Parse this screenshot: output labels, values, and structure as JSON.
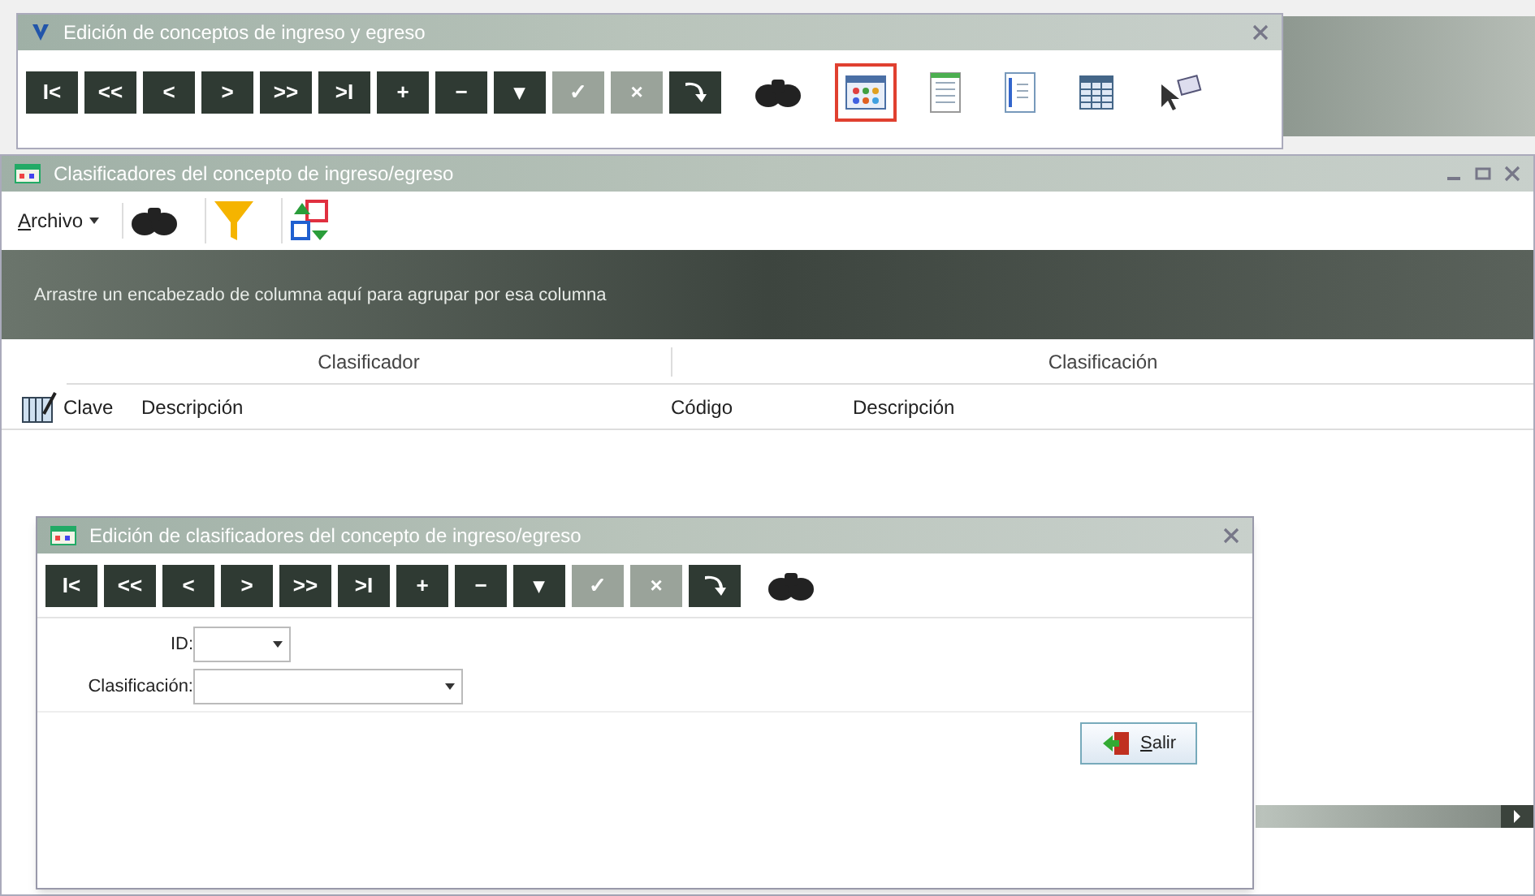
{
  "main_window": {
    "title": "Edición de conceptos de ingreso y egreso",
    "nav_buttons": [
      {
        "label": "I<",
        "disabled": false
      },
      {
        "label": "<<",
        "disabled": false
      },
      {
        "label": "<",
        "disabled": false
      },
      {
        "label": ">",
        "disabled": false
      },
      {
        "label": ">>",
        "disabled": false
      },
      {
        "label": ">I",
        "disabled": false
      },
      {
        "label": "+",
        "disabled": false
      },
      {
        "label": "−",
        "disabled": false
      },
      {
        "label": "▾",
        "disabled": false
      },
      {
        "label": "✓",
        "disabled": true
      },
      {
        "label": "×",
        "disabled": true
      },
      {
        "kind": "redo",
        "disabled": false
      }
    ],
    "tools": [
      {
        "kind": "binoculars",
        "selected": false
      },
      {
        "kind": "grid",
        "selected": true
      },
      {
        "kind": "list",
        "selected": false
      },
      {
        "kind": "details",
        "selected": false
      },
      {
        "kind": "table",
        "selected": false
      },
      {
        "kind": "pointer",
        "selected": false
      }
    ]
  },
  "grid_window": {
    "title": "Clasificadores del concepto de ingreso/egreso",
    "menu": "Archivo",
    "tools": [
      {
        "kind": "binoculars"
      },
      {
        "kind": "filter"
      },
      {
        "kind": "translate"
      }
    ],
    "group_panel": "Arrastre un encabezado de columna aquí para agrupar por esa columna",
    "column_groups": [
      "Clasificador",
      "Clasificación"
    ],
    "columns": [
      "Clave",
      "Descripción",
      "Código",
      "Descripción"
    ]
  },
  "dialog": {
    "title": "Edición de clasificadores del concepto de ingreso/egreso",
    "nav_buttons": [
      {
        "label": "I<",
        "disabled": false
      },
      {
        "label": "<<",
        "disabled": false
      },
      {
        "label": "<",
        "disabled": false
      },
      {
        "label": ">",
        "disabled": false
      },
      {
        "label": ">>",
        "disabled": false
      },
      {
        "label": ">I",
        "disabled": false
      },
      {
        "label": "+",
        "disabled": false
      },
      {
        "label": "−",
        "disabled": false
      },
      {
        "label": "▾",
        "disabled": false
      },
      {
        "label": "✓",
        "disabled": true
      },
      {
        "label": "×",
        "disabled": true
      },
      {
        "kind": "redo",
        "disabled": false
      }
    ],
    "tools": [
      {
        "kind": "binoculars"
      }
    ],
    "fields": [
      {
        "label": "ID:",
        "kind": "short"
      },
      {
        "label": "Clasificación:",
        "kind": "long"
      }
    ],
    "button": "Salir"
  }
}
